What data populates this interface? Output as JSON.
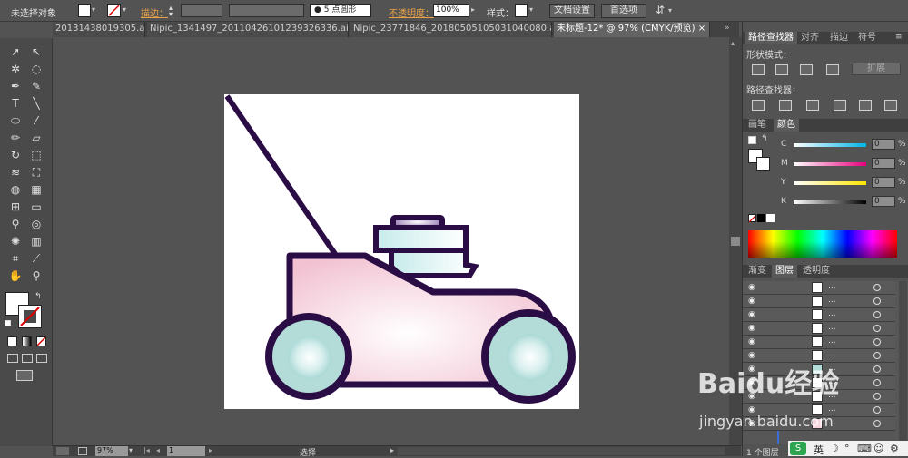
{
  "controlbar": {
    "selection_label": "未选择对象",
    "stroke_label": "描边：",
    "brush_label": "5 点圆形",
    "opacity_label": "不透明度：",
    "opacity_value": "100%",
    "style_label": "样式：",
    "doc_setup": "文档设置",
    "preferences": "首选项"
  },
  "tabs": [
    {
      "label": "20131438019305.ai*"
    },
    {
      "label": "Nipic_1341497_20110426101239326336.ai*"
    },
    {
      "label": "Nipic_23771846_20180505105031040080.ai*"
    },
    {
      "label": "未标题-12* @ 97% (CMYK/预览)"
    }
  ],
  "tab_close": "×",
  "statusbar": {
    "zoom": "97%",
    "page": "1",
    "mode": "选择"
  },
  "pathfinder": {
    "tabs": [
      "路径查找器",
      "对齐",
      "描边",
      "符号"
    ],
    "shape_modes": "形状模式：",
    "expand": "扩展",
    "pathfinders": "路径查找器："
  },
  "color_panel": {
    "tabs": [
      "画笔",
      "颜色"
    ],
    "channels": [
      {
        "name": "C",
        "value": "0",
        "unit": "%"
      },
      {
        "name": "M",
        "value": "0",
        "unit": "%"
      },
      {
        "name": "Y",
        "value": "0",
        "unit": "%"
      },
      {
        "name": "K",
        "value": "0",
        "unit": "%"
      }
    ]
  },
  "layers_panel": {
    "tabs": [
      "渐变",
      "图层",
      "透明度"
    ],
    "row_label": "...",
    "footer": "1 个图层"
  },
  "watermark": {
    "brand": "Baidu经验",
    "url": "jingyan.baidu.com"
  },
  "ime": {
    "lang": "英"
  },
  "colors": {
    "mower_outline": "#2b0d45",
    "mower_body_pink": "#f7d5df",
    "wheel_teal": "#b3dcd9",
    "engine_cyan": "#ddf1f1"
  }
}
